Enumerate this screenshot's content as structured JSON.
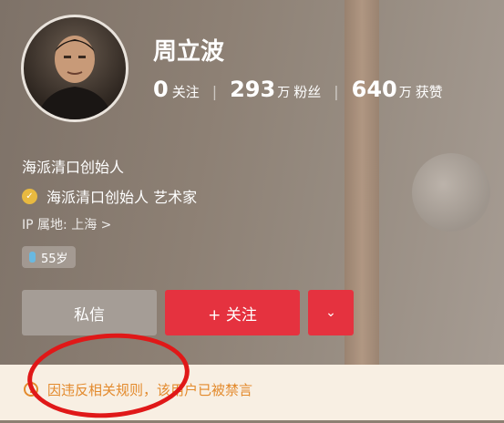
{
  "profile": {
    "name": "周立波",
    "stats": [
      {
        "num": "0",
        "unit": "",
        "label": "关注"
      },
      {
        "num": "293",
        "unit": "万",
        "label": "粉丝"
      },
      {
        "num": "640",
        "unit": "万",
        "label": "获赞"
      }
    ],
    "bio": "海派清口创始人",
    "verification": "海派清口创始人 艺术家",
    "ip_location": "IP 属地: 上海 >",
    "age": "55岁"
  },
  "actions": {
    "message_label": "私信",
    "follow_label": "+ 关注",
    "more_label": "⌄"
  },
  "notice": {
    "text": "因违反相关规则，该用户已被禁言",
    "icon": "warning-icon"
  },
  "colors": {
    "accent": "#e5323f",
    "notice_text": "#e38a2c",
    "notice_bg": "#f8efe3",
    "annotation_circle": "#e01818"
  }
}
